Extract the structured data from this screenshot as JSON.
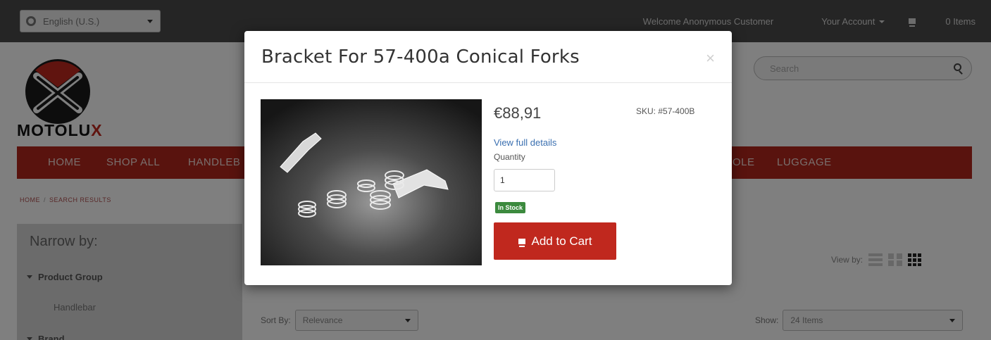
{
  "topbar": {
    "language": "English (U.S.)",
    "welcome": "Welcome Anonymous Customer",
    "account": "Your Account",
    "cart": "0 Items"
  },
  "brand": {
    "logo_prefix": "MOTOLU",
    "logo_suffix": "X"
  },
  "search": {
    "placeholder": "Search"
  },
  "nav": {
    "items": [
      "HOME",
      "SHOP ALL",
      "HANDLEB",
      "OLE",
      "LUGGAGE"
    ]
  },
  "breadcrumb": {
    "home": "HOME",
    "current": "SEARCH RESULTS"
  },
  "sidebar": {
    "title": "Narrow by:",
    "groups": [
      "Product Group",
      "Brand"
    ],
    "options": [
      "Handlebar"
    ]
  },
  "listing": {
    "view_by_label": "View by:",
    "sort_label": "Sort By:",
    "sort_value": "Relevance",
    "show_label": "Show:",
    "show_value": "24 Items"
  },
  "modal": {
    "title": "Bracket For 57-400a Conical Forks",
    "close": "×",
    "price": "€88,91",
    "sku": "SKU: #57-400B",
    "full_details": "View full details",
    "quantity_label": "Quantity",
    "quantity_value": "1",
    "stock": "In Stock",
    "add_to_cart": "Add to Cart"
  },
  "colors": {
    "accent": "#b3261c",
    "button": "#c0281e",
    "stock": "#3c8a3e",
    "link": "#3a6fb0",
    "topbar": "#4a4a4a"
  },
  "icons": [
    "globe-icon",
    "cart-icon",
    "search-icon",
    "close-icon",
    "view-list-icon",
    "view-grid-icon",
    "view-grid-dense-icon"
  ]
}
